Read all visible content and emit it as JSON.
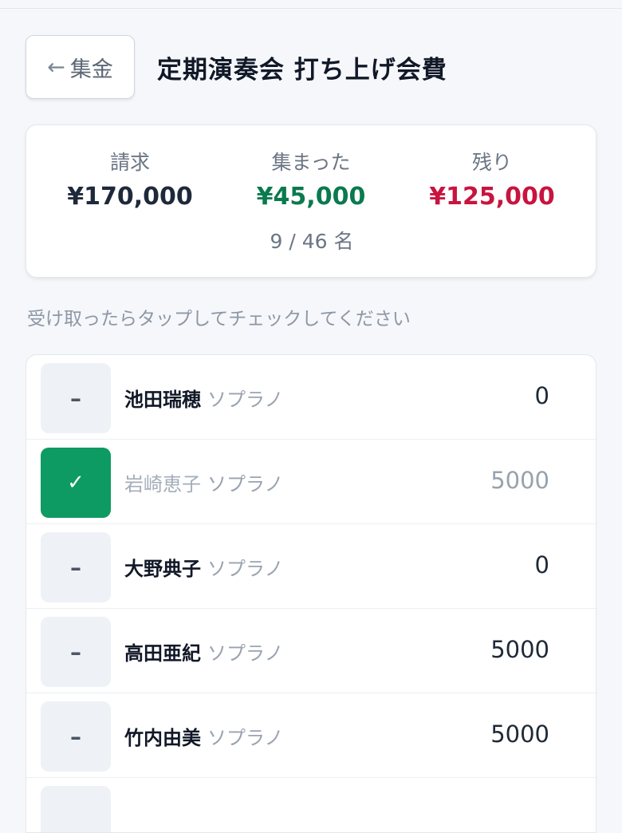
{
  "header": {
    "back_arrow": "←",
    "back_label": "集金",
    "title": "定期演奏会 打ち上げ会費"
  },
  "summary": {
    "billed_label": "請求",
    "billed_value": "¥170,000",
    "collected_label": "集まった",
    "collected_value": "¥45,000",
    "remaining_label": "残り",
    "remaining_value": "¥125,000",
    "count": "9 / 46 名"
  },
  "hint": "受け取ったらタップしてチェックしてください",
  "colors": {
    "collected": "#0a7a4f",
    "remaining": "#c8143f",
    "check_done": "#0e9a63"
  },
  "members": [
    {
      "name": "池田瑞穂",
      "part": "ソプラノ",
      "amount": "0",
      "paid": false,
      "mark": "–"
    },
    {
      "name": "岩崎恵子",
      "part": "ソプラノ",
      "amount": "5000",
      "paid": true,
      "mark": "✓"
    },
    {
      "name": "大野典子",
      "part": "ソプラノ",
      "amount": "0",
      "paid": false,
      "mark": "–"
    },
    {
      "name": "高田亜紀",
      "part": "ソプラノ",
      "amount": "5000",
      "paid": false,
      "mark": "–"
    },
    {
      "name": "竹内由美",
      "part": "ソプラノ",
      "amount": "5000",
      "paid": false,
      "mark": "–"
    }
  ]
}
